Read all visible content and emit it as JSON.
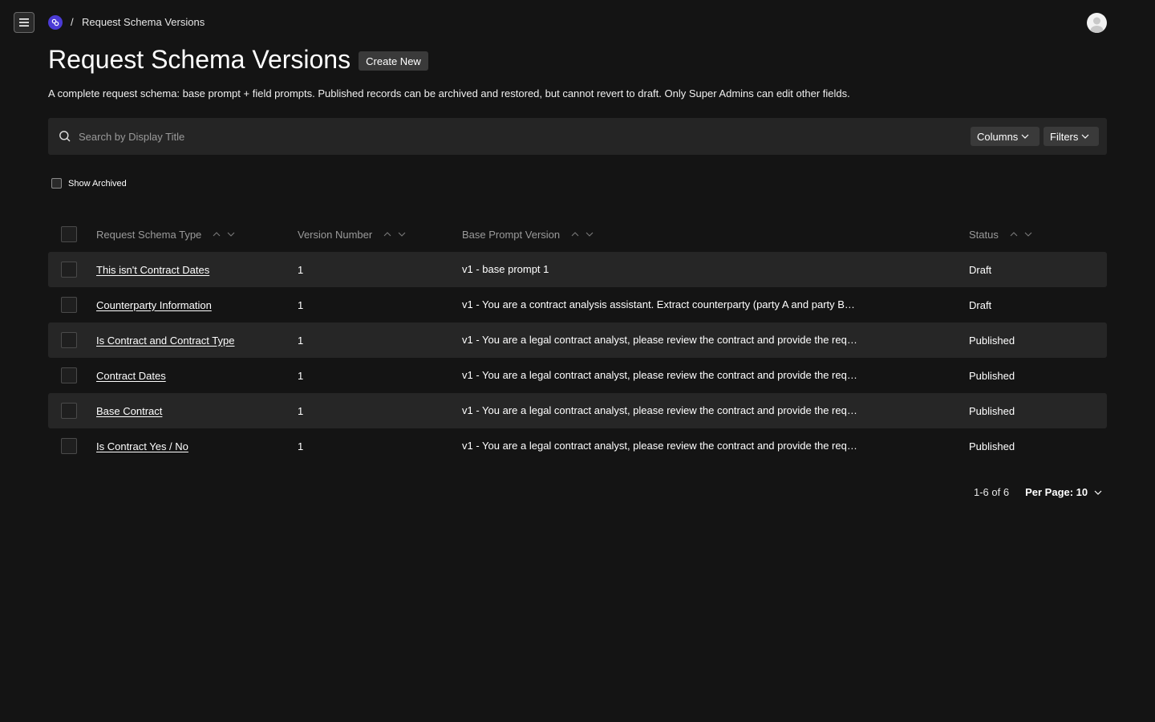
{
  "breadcrumb": {
    "separator": "/",
    "current": "Request Schema Versions"
  },
  "page": {
    "title": "Request Schema Versions",
    "create_label": "Create New",
    "description": "A complete request schema: base prompt + field prompts. Published records can be archived and restored, but cannot revert to draft. Only Super Admins can edit other fields."
  },
  "search": {
    "placeholder": "Search by Display Title"
  },
  "controls": {
    "columns_label": "Columns",
    "filters_label": "Filters",
    "show_archived_label": "Show Archived"
  },
  "table": {
    "headers": {
      "type": "Request Schema Type",
      "version": "Version Number",
      "base_prompt": "Base Prompt Version",
      "status": "Status"
    },
    "rows": [
      {
        "type": "This isn't Contract Dates",
        "version": "1",
        "base_prompt": "v1 - base prompt 1",
        "status": "Draft"
      },
      {
        "type": "Counterparty Information",
        "version": "1",
        "base_prompt": "v1 - You are a contract analysis assistant. Extract counterparty (party A and party B…",
        "status": "Draft"
      },
      {
        "type": "Is Contract and Contract Type",
        "version": "1",
        "base_prompt": "v1 - You are a legal contract analyst, please review the contract and provide the req…",
        "status": "Published"
      },
      {
        "type": "Contract Dates",
        "version": "1",
        "base_prompt": "v1 - You are a legal contract analyst, please review the contract and provide the req…",
        "status": "Published"
      },
      {
        "type": "Base Contract",
        "version": "1",
        "base_prompt": "v1 - You are a legal contract analyst, please review the contract and provide the req…",
        "status": "Published"
      },
      {
        "type": "Is Contract Yes / No",
        "version": "1",
        "base_prompt": "v1 - You are a legal contract analyst, please review the contract and provide the req…",
        "status": "Published"
      }
    ]
  },
  "pagination": {
    "range": "1-6 of 6",
    "per_page": "Per Page: 10"
  },
  "colors": {
    "background": "#141414",
    "row_alt": "#262626",
    "logo": "#4b3bd6"
  }
}
